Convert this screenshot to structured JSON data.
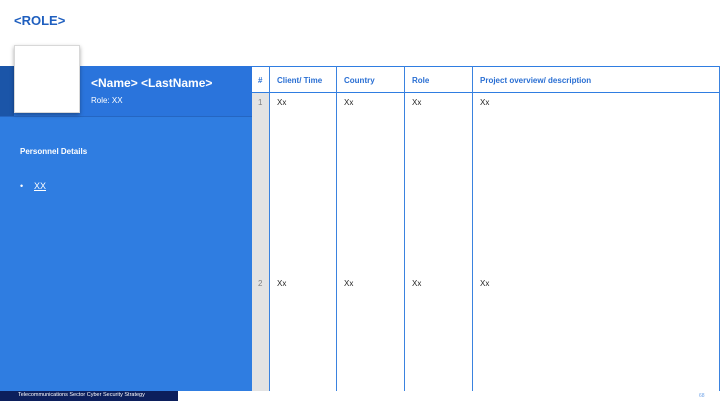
{
  "page": {
    "role_title": "<ROLE>"
  },
  "profile": {
    "name": "<Name> <LastName>",
    "role_line": "Role: XX",
    "details_heading": "Personnel Details",
    "bullet": "•",
    "detail_item": "XX"
  },
  "table": {
    "headers": {
      "num": "#",
      "client": "Client/ Time",
      "country": "Country",
      "role": "Role",
      "overview": "Project overview/ description"
    },
    "rows": [
      {
        "num": "1",
        "client": "Xx",
        "country": "Xx",
        "role": "Xx",
        "overview": "Xx"
      },
      {
        "num": "2",
        "client": "Xx",
        "country": "Xx",
        "role": "Xx",
        "overview": "Xx"
      }
    ]
  },
  "footer": {
    "text": "Telecommunications Sector Cyber Security Strategy",
    "page_number": "68"
  },
  "colors": {
    "accent_blue": "#2f7de1",
    "title_blue": "#1f5fbf",
    "footer_navy": "#0c1f5c"
  }
}
